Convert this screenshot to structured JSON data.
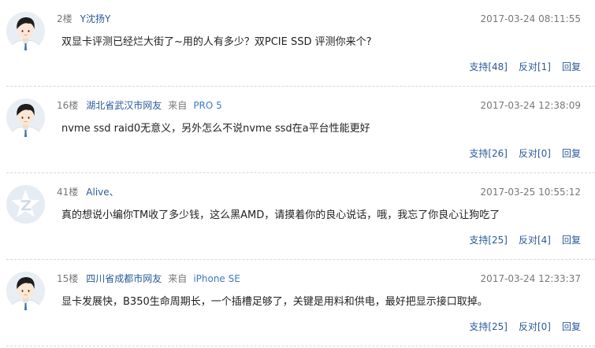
{
  "comments": [
    {
      "floor": "2楼",
      "user": "Y沈扬Y",
      "from": "",
      "device": "",
      "time": "2017-03-24 08:11:55",
      "text": "双显卡评测已经烂大街了~用的人有多少？双PCIE SSD 评测你来个?",
      "support": "支持[48]",
      "oppose": "反对[1]",
      "reply": "回复",
      "avatar": "cartoon-man"
    },
    {
      "floor": "16楼",
      "user": "湖北省武汉市网友",
      "from": "来自",
      "device": "PRO 5",
      "time": "2017-03-24 12:38:09",
      "text": "nvme ssd raid0无意义，另外怎么不说nvme ssd在a平台性能更好",
      "support": "支持[26]",
      "oppose": "反对[0]",
      "reply": "回复",
      "avatar": "cartoon-man"
    },
    {
      "floor": "41楼",
      "user": "Alive、",
      "from": "",
      "device": "",
      "time": "2017-03-25 10:55:12",
      "text": "真的想说小编你TM收了多少钱，这么黑AMD，请摸着你的良心说话，哦，我忘了你良心让狗吃了",
      "support": "支持[25]",
      "oppose": "反对[4]",
      "reply": "回复",
      "avatar": "star-logo"
    },
    {
      "floor": "15楼",
      "user": "四川省成都市网友",
      "from": "来自",
      "device": "iPhone SE",
      "time": "2017-03-24 12:33:37",
      "text": "显卡发展快，B350生命周期长，一个插槽足够了，关键是用料和供电，最好把显示接口取掉。",
      "support": "支持[25]",
      "oppose": "反对[0]",
      "reply": "回复",
      "avatar": "cartoon-man"
    }
  ],
  "colors": {
    "link": "#2a5a9a",
    "device": "#3e7bc4",
    "meta": "#777777",
    "divider": "#d6d6d6"
  }
}
